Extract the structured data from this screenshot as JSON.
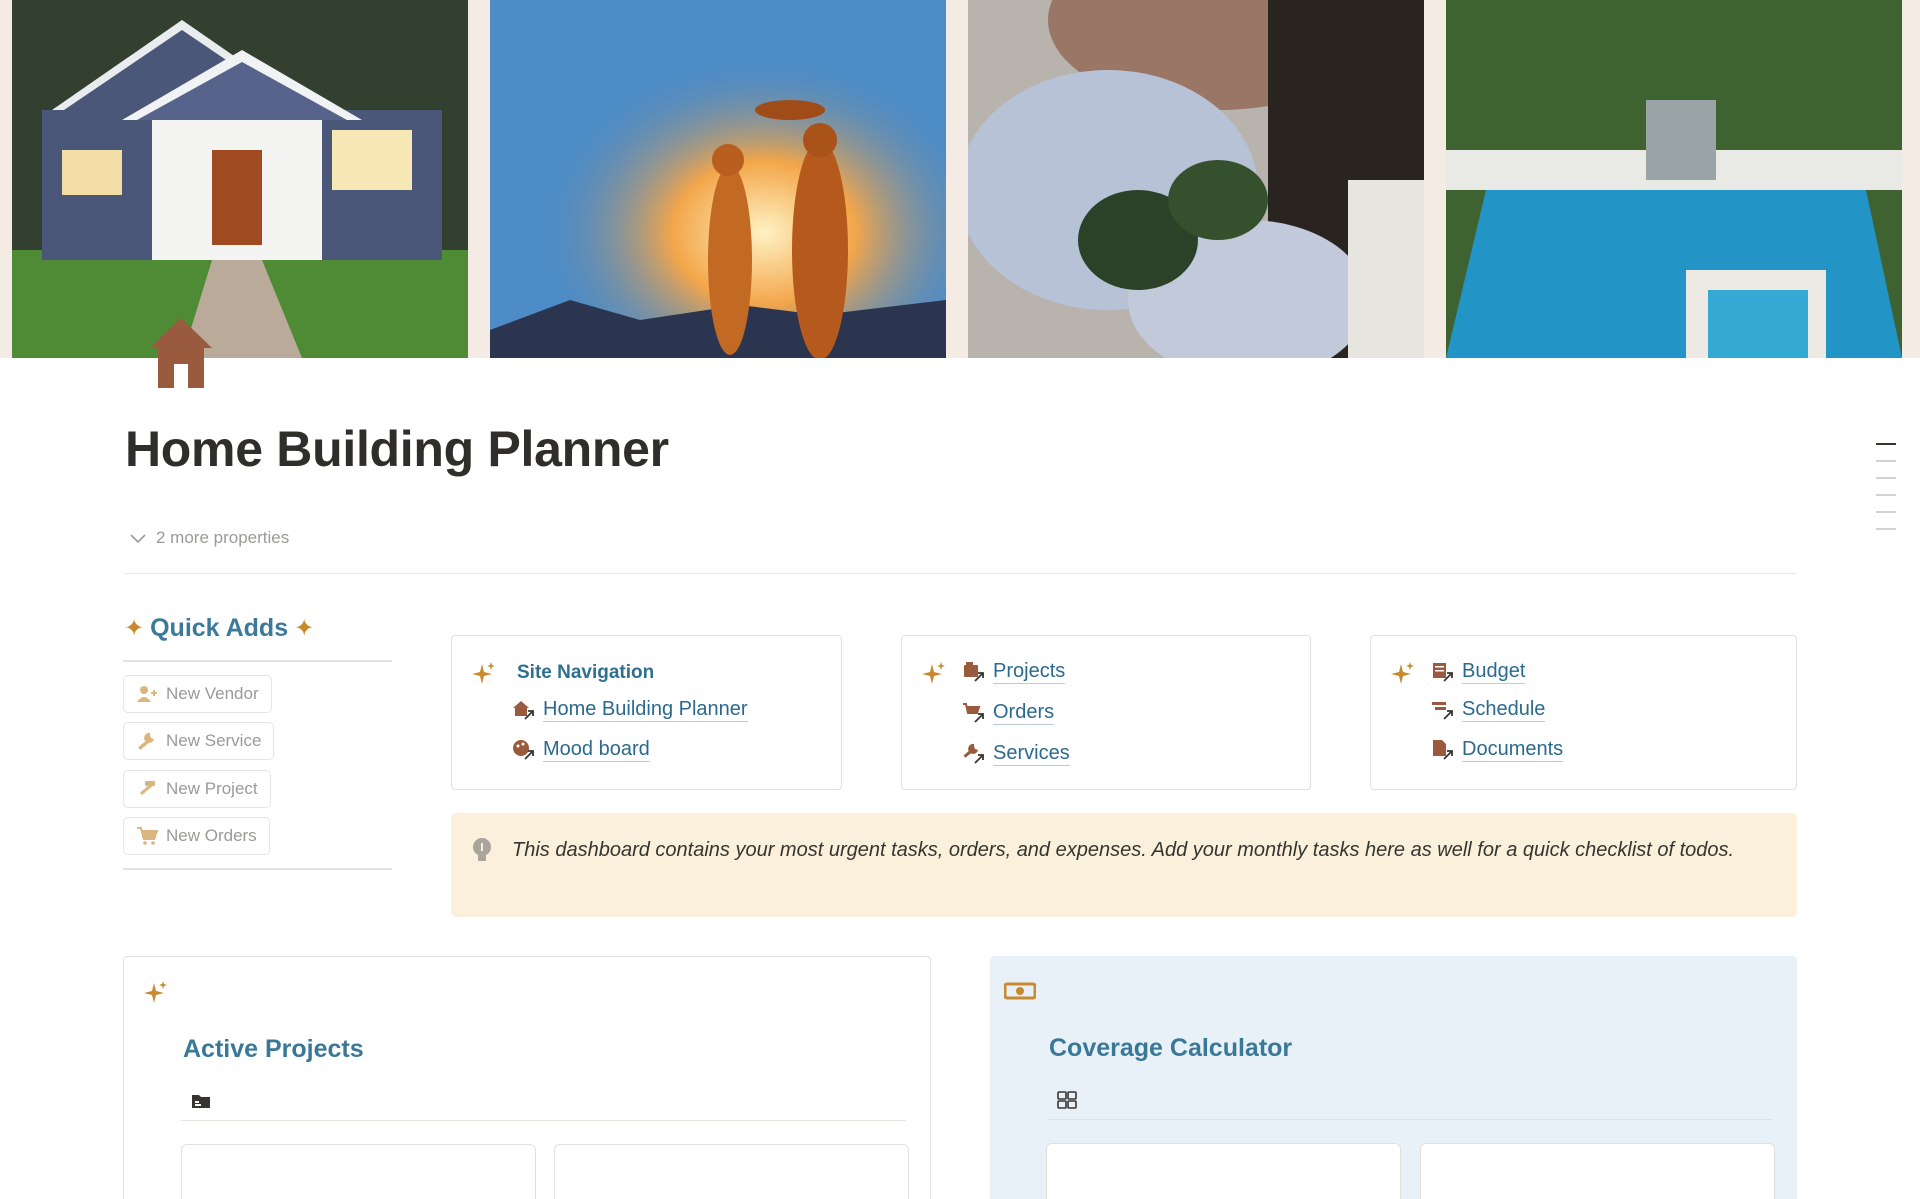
{
  "cover": {
    "images": [
      "house-exterior-image",
      "family-silhouette-image",
      "woman-hydrangeas-image",
      "backyard-pool-image"
    ]
  },
  "page": {
    "icon": "house-icon",
    "title": "Home Building Planner",
    "more_properties": "2 more properties"
  },
  "quick_adds": {
    "title": "Quick Adds",
    "buttons": [
      {
        "label": "New Vendor",
        "icon": "add-person-icon"
      },
      {
        "label": "New Service",
        "icon": "wrench-icon"
      },
      {
        "label": "New Project",
        "icon": "hammer-icon"
      },
      {
        "label": "New Orders",
        "icon": "cart-icon"
      }
    ]
  },
  "nav_cards": [
    {
      "heading": "Site Navigation",
      "links": [
        {
          "label": "Home Building Planner",
          "icon": "house-link-icon"
        },
        {
          "label": "Mood board",
          "icon": "palette-link-icon"
        }
      ]
    },
    {
      "links": [
        {
          "label": "Projects",
          "icon": "projects-link-icon"
        },
        {
          "label": "Orders",
          "icon": "cart-link-icon"
        },
        {
          "label": "Services",
          "icon": "wrench-link-icon"
        }
      ]
    },
    {
      "links": [
        {
          "label": "Budget",
          "icon": "budget-link-icon"
        },
        {
          "label": "Schedule",
          "icon": "schedule-link-icon"
        },
        {
          "label": "Documents",
          "icon": "document-link-icon"
        }
      ]
    }
  ],
  "callout": {
    "icon": "lightbulb-icon",
    "text": "This dashboard contains your most urgent tasks, orders, and expenses. Add your monthly tasks here as well for a quick checklist of todos."
  },
  "sections": {
    "active_projects": {
      "title": "Active Projects",
      "icon": "sparkles-icon",
      "view_icon": "folder-icon"
    },
    "coverage_calculator": {
      "title": "Coverage Calculator",
      "icon": "money-icon",
      "view_icon": "gallery-icon"
    }
  },
  "colors": {
    "accent_blue": "#3b7a9b",
    "link_blue": "#2b6a8e",
    "accent_gold": "#c98a2f",
    "icon_brown": "#9a5a3e",
    "callout_bg": "#faf0dc",
    "section_bg": "#e8f1f8"
  }
}
